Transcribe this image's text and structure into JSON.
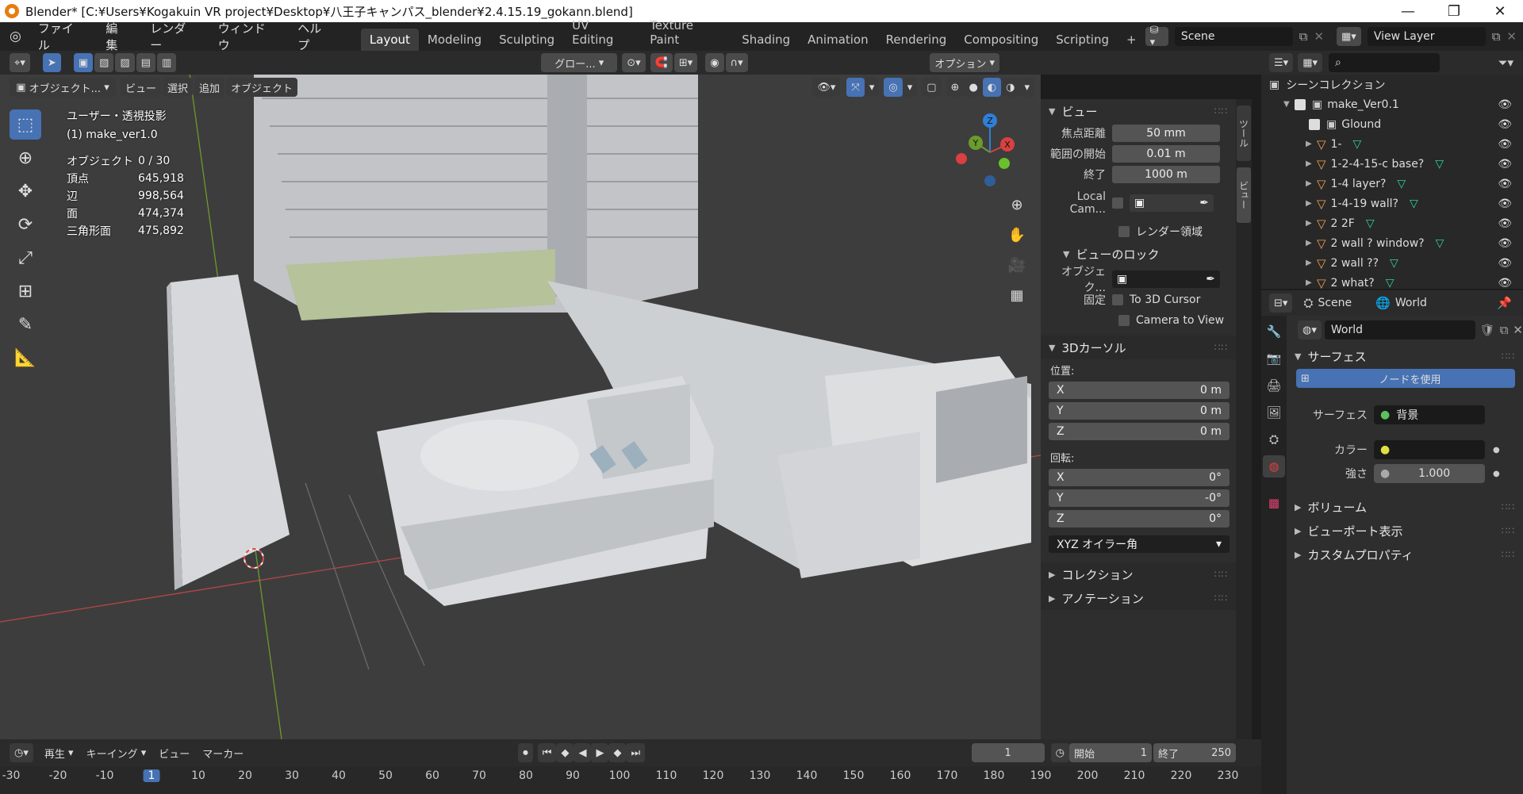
{
  "window": {
    "title": "Blender* [C:¥Users¥Kogakuin VR project¥Desktop¥八王子キャンパス_blender¥2.4.15.19_gokann.blend]"
  },
  "menu": [
    "ファイル",
    "編集",
    "レンダー",
    "ウィンドウ",
    "ヘルプ"
  ],
  "workspaces": [
    "Layout",
    "Modeling",
    "Sculpting",
    "UV Editing",
    "Texture Paint",
    "Shading",
    "Animation",
    "Rendering",
    "Compositing",
    "Scripting"
  ],
  "active_workspace": "Layout",
  "scene": {
    "name": "Scene",
    "view_layer": "View Layer"
  },
  "viewport_header": {
    "mode": "オブジェクト...",
    "menus": [
      "ビュー",
      "選択",
      "追加",
      "オブジェクト"
    ],
    "transform": "グロー...",
    "options": "オプション"
  },
  "viewport_overlay": {
    "view_name": "ユーザー・透視投影",
    "collection": "(1) make_ver1.0",
    "stats": [
      {
        "label": "オブジェクト",
        "value": "0 / 30"
      },
      {
        "label": "頂点",
        "value": "645,918"
      },
      {
        "label": "辺",
        "value": "998,564"
      },
      {
        "label": "面",
        "value": "474,374"
      },
      {
        "label": "三角形面",
        "value": "475,892"
      }
    ]
  },
  "gizmo": {
    "z": "Z",
    "y": "Y",
    "x": "X"
  },
  "npanel": {
    "tabs": [
      "ツール",
      "ビュー"
    ],
    "view": {
      "title": "ビュー",
      "focal_label": "焦点距離",
      "focal": "50 mm",
      "clip_start_label": "範囲の開始",
      "clip_start": "0.01 m",
      "clip_end_label": "終了",
      "clip_end": "1000 m",
      "local_cam_label": "Local Cam...",
      "render_region": "レンダー領域",
      "lock_title": "ビューのロック",
      "lock_object_label": "オブジェク...",
      "lock_label": "固定",
      "to_cursor": "To 3D Cursor",
      "cam_to_view": "Camera to View"
    },
    "cursor": {
      "title": "3Dカーソル",
      "location_label": "位置:",
      "location": [
        {
          "axis": "X",
          "value": "0 m"
        },
        {
          "axis": "Y",
          "value": "0 m"
        },
        {
          "axis": "Z",
          "value": "0 m"
        }
      ],
      "rotation_label": "回転:",
      "rotation": [
        {
          "axis": "X",
          "value": "0°"
        },
        {
          "axis": "Y",
          "value": "-0°"
        },
        {
          "axis": "Z",
          "value": "0°"
        }
      ],
      "rotation_mode": "XYZ オイラー角"
    },
    "collections": "コレクション",
    "annotations": "アノテーション"
  },
  "outliner": {
    "root": "シーンコレクション",
    "items": [
      {
        "name": "make_Ver0.1",
        "type": "collection",
        "indent": 1
      },
      {
        "name": "Glound",
        "type": "collection",
        "indent": 2
      },
      {
        "name": "1-",
        "type": "object",
        "indent": 2
      },
      {
        "name": "1-2-4-15-c base?",
        "type": "object",
        "indent": 2
      },
      {
        "name": "1-4 layer?",
        "type": "object",
        "indent": 2
      },
      {
        "name": "1-4-19 wall?",
        "type": "object",
        "indent": 2
      },
      {
        "name": "2 2F",
        "type": "object",
        "indent": 2
      },
      {
        "name": "2 wall ? window?",
        "type": "object",
        "indent": 2
      },
      {
        "name": "2 wall ??",
        "type": "object",
        "indent": 2
      },
      {
        "name": "2 what?",
        "type": "object",
        "indent": 2
      }
    ]
  },
  "properties": {
    "scene_tab": "Scene",
    "world_tab": "World",
    "world_name": "World",
    "surface_title": "サーフェス",
    "use_nodes": "ノードを使用",
    "surface_label": "サーフェス",
    "surface_value": "背景",
    "color_label": "カラー",
    "strength_label": "強さ",
    "strength": "1.000",
    "sections": [
      "ボリューム",
      "ビューポート表示",
      "カスタムプロパティ"
    ]
  },
  "timeline": {
    "menus": [
      "再生",
      "キーイング",
      "ビュー",
      "マーカー"
    ],
    "current_frame": "1",
    "start_label": "開始",
    "start": "1",
    "end_label": "終了",
    "end": "250",
    "ticks": [
      "-30",
      "-20",
      "-10",
      "1",
      "10",
      "20",
      "30",
      "40",
      "50",
      "60",
      "70",
      "80",
      "90",
      "100",
      "110",
      "120",
      "130",
      "140",
      "150",
      "160",
      "170",
      "180",
      "190",
      "200",
      "210",
      "220",
      "230"
    ]
  }
}
